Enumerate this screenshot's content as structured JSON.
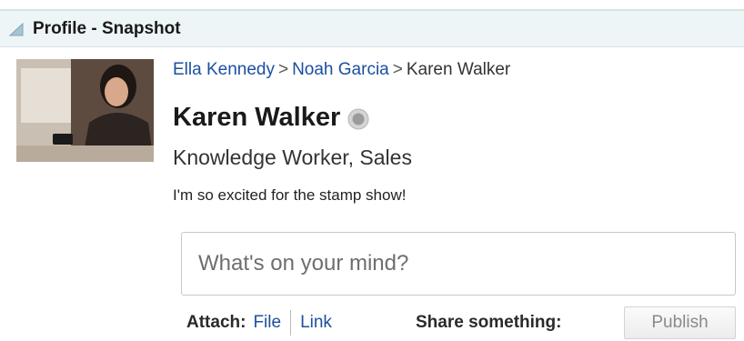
{
  "panel": {
    "title": "Profile - Snapshot"
  },
  "breadcrumb": {
    "items": [
      "Ella Kennedy",
      "Noah Garcia",
      "Karen Walker"
    ],
    "separator": ">"
  },
  "profile": {
    "name": "Karen Walker",
    "job_title": "Knowledge Worker, Sales",
    "status_message": "I'm so excited for the stamp show!",
    "presence_icon": "presence-offline-icon"
  },
  "composer": {
    "placeholder": "What's on your mind?",
    "attach_label": "Attach:",
    "file_link": "File",
    "link_link": "Link",
    "share_label": "Share something:",
    "publish_label": "Publish"
  },
  "colors": {
    "header_bg": "#eef5f7",
    "link": "#1c4fa0"
  }
}
